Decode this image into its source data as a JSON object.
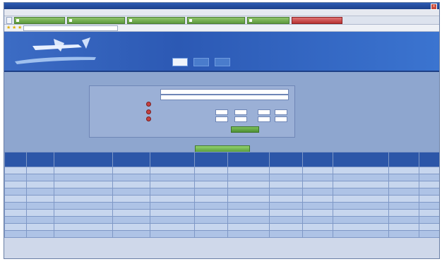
{
  "window": {
    "title": "",
    "close_label": "x"
  },
  "menu": {
    "items": []
  },
  "toolbar": {
    "label": ""
  },
  "address": {
    "url": ""
  },
  "banner": {
    "site_title": "",
    "site_subtitle": "",
    "tabs": [
      "",
      "",
      ""
    ]
  },
  "page": {
    "heading": ""
  },
  "form": {
    "field1_label": "",
    "field2_label": "",
    "field3_label": "",
    "radio1_label": "",
    "field4_label": "",
    "radio2_label": "",
    "field5_label": "",
    "radio3_label": "",
    "submit_label": ""
  },
  "export_label": "",
  "table": {
    "headers": [
      "",
      "",
      "",
      "",
      "",
      "",
      "",
      "",
      "",
      "",
      "",
      "",
      ""
    ],
    "rows": [
      [
        "",
        "",
        "",
        "",
        "",
        "",
        "",
        "",
        "",
        "",
        "",
        "",
        ""
      ],
      [
        "",
        "",
        "",
        "",
        "",
        "",
        "",
        "",
        "",
        "",
        "",
        "",
        ""
      ],
      [
        "",
        "",
        "",
        "",
        "",
        "",
        "",
        "",
        "",
        "",
        "",
        "",
        ""
      ],
      [
        "",
        "",
        "",
        "",
        "",
        "",
        "",
        "",
        "",
        "",
        "",
        "",
        ""
      ],
      [
        "",
        "",
        "",
        "",
        "",
        "",
        "",
        "",
        "",
        "",
        "",
        "",
        ""
      ],
      [
        "",
        "",
        "",
        "",
        "",
        "",
        "",
        "",
        "",
        "",
        "",
        "",
        ""
      ],
      [
        "",
        "",
        "",
        "",
        "",
        "",
        "",
        "",
        "",
        "",
        "",
        "",
        ""
      ],
      [
        "",
        "",
        "",
        "",
        "",
        "",
        "",
        "",
        "",
        "",
        "",
        "",
        ""
      ],
      [
        "",
        "",
        "",
        "",
        "",
        "",
        "",
        "",
        "",
        "",
        "",
        "",
        ""
      ],
      [
        "",
        "",
        "",
        "",
        "",
        "",
        "",
        "",
        "",
        "",
        "",
        "",
        ""
      ]
    ]
  },
  "colors": {
    "banner": "#2c59b4",
    "content_bg": "#8ea6cf",
    "accent_green": "#5e9a3e",
    "accent_red": "#b83333"
  },
  "icons": {
    "logo": "airplane-logo-icon",
    "close": "close-icon",
    "favorite": "star-icon"
  }
}
